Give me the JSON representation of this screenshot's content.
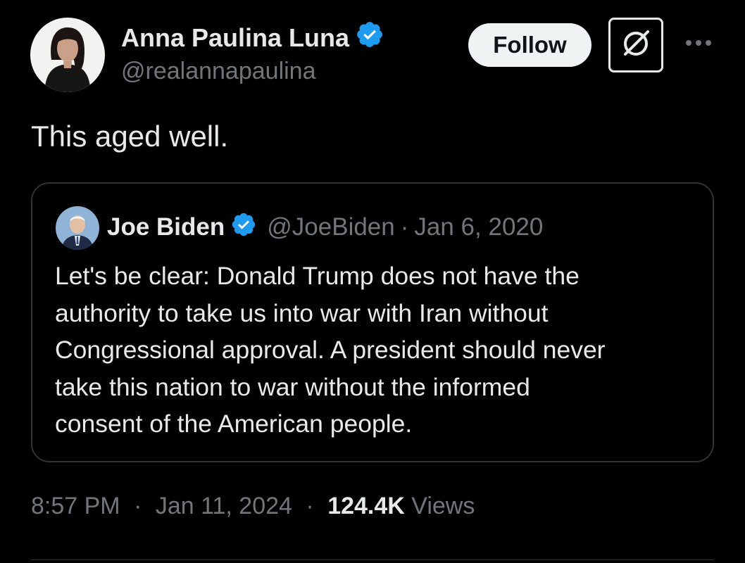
{
  "author": {
    "name": "Anna Paulina Luna",
    "handle": "@realannapaulina",
    "verified": true
  },
  "actions": {
    "follow_label": "Follow",
    "grok_icon": "grok-icon",
    "more_icon": "more-dots-icon"
  },
  "tweet": {
    "text": "This aged well."
  },
  "quote": {
    "name": "Joe Biden",
    "handle": "@JoeBiden",
    "separator": "·",
    "date": "Jan 6, 2020",
    "verified": true,
    "lines": [
      "Let's be clear: Donald Trump does not have the",
      "authority to take us into war with Iran without",
      "Congressional approval. A president should never",
      "take this nation to war without the informed",
      "consent of the American people."
    ]
  },
  "meta": {
    "time": "8:57 PM",
    "separator": "·",
    "date": "Jan 11, 2024",
    "views_count": "124.4K",
    "views_label": "Views"
  },
  "colors": {
    "background": "#000000",
    "text_primary": "#e7e9ea",
    "text_secondary": "#71767b",
    "verified_blue": "#1d9bf0",
    "border": "#2f3336",
    "follow_bg": "#eff3f4"
  }
}
